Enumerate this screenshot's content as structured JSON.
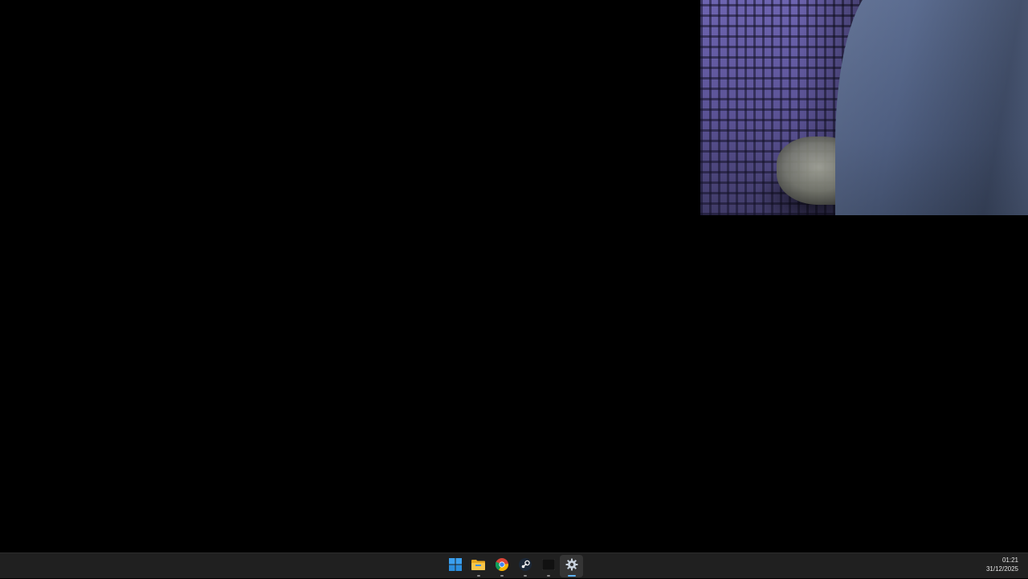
{
  "taskbar": {
    "apps": [
      {
        "name": "Start",
        "icon": "windows-start-icon"
      },
      {
        "name": "File Explorer",
        "icon": "folder-icon"
      },
      {
        "name": "Browser",
        "icon": "browser-icon"
      },
      {
        "name": "Steam",
        "icon": "steam-icon"
      },
      {
        "name": "Terminal",
        "icon": "terminal-icon"
      },
      {
        "name": "Settings",
        "icon": "settings-gear-icon"
      }
    ],
    "clock": {
      "time": "01:21",
      "date": "31/12/2025"
    }
  },
  "colors": {
    "desktop_background": "#000000",
    "taskbar_background": "#202020",
    "accent": "#5fb2f2"
  }
}
